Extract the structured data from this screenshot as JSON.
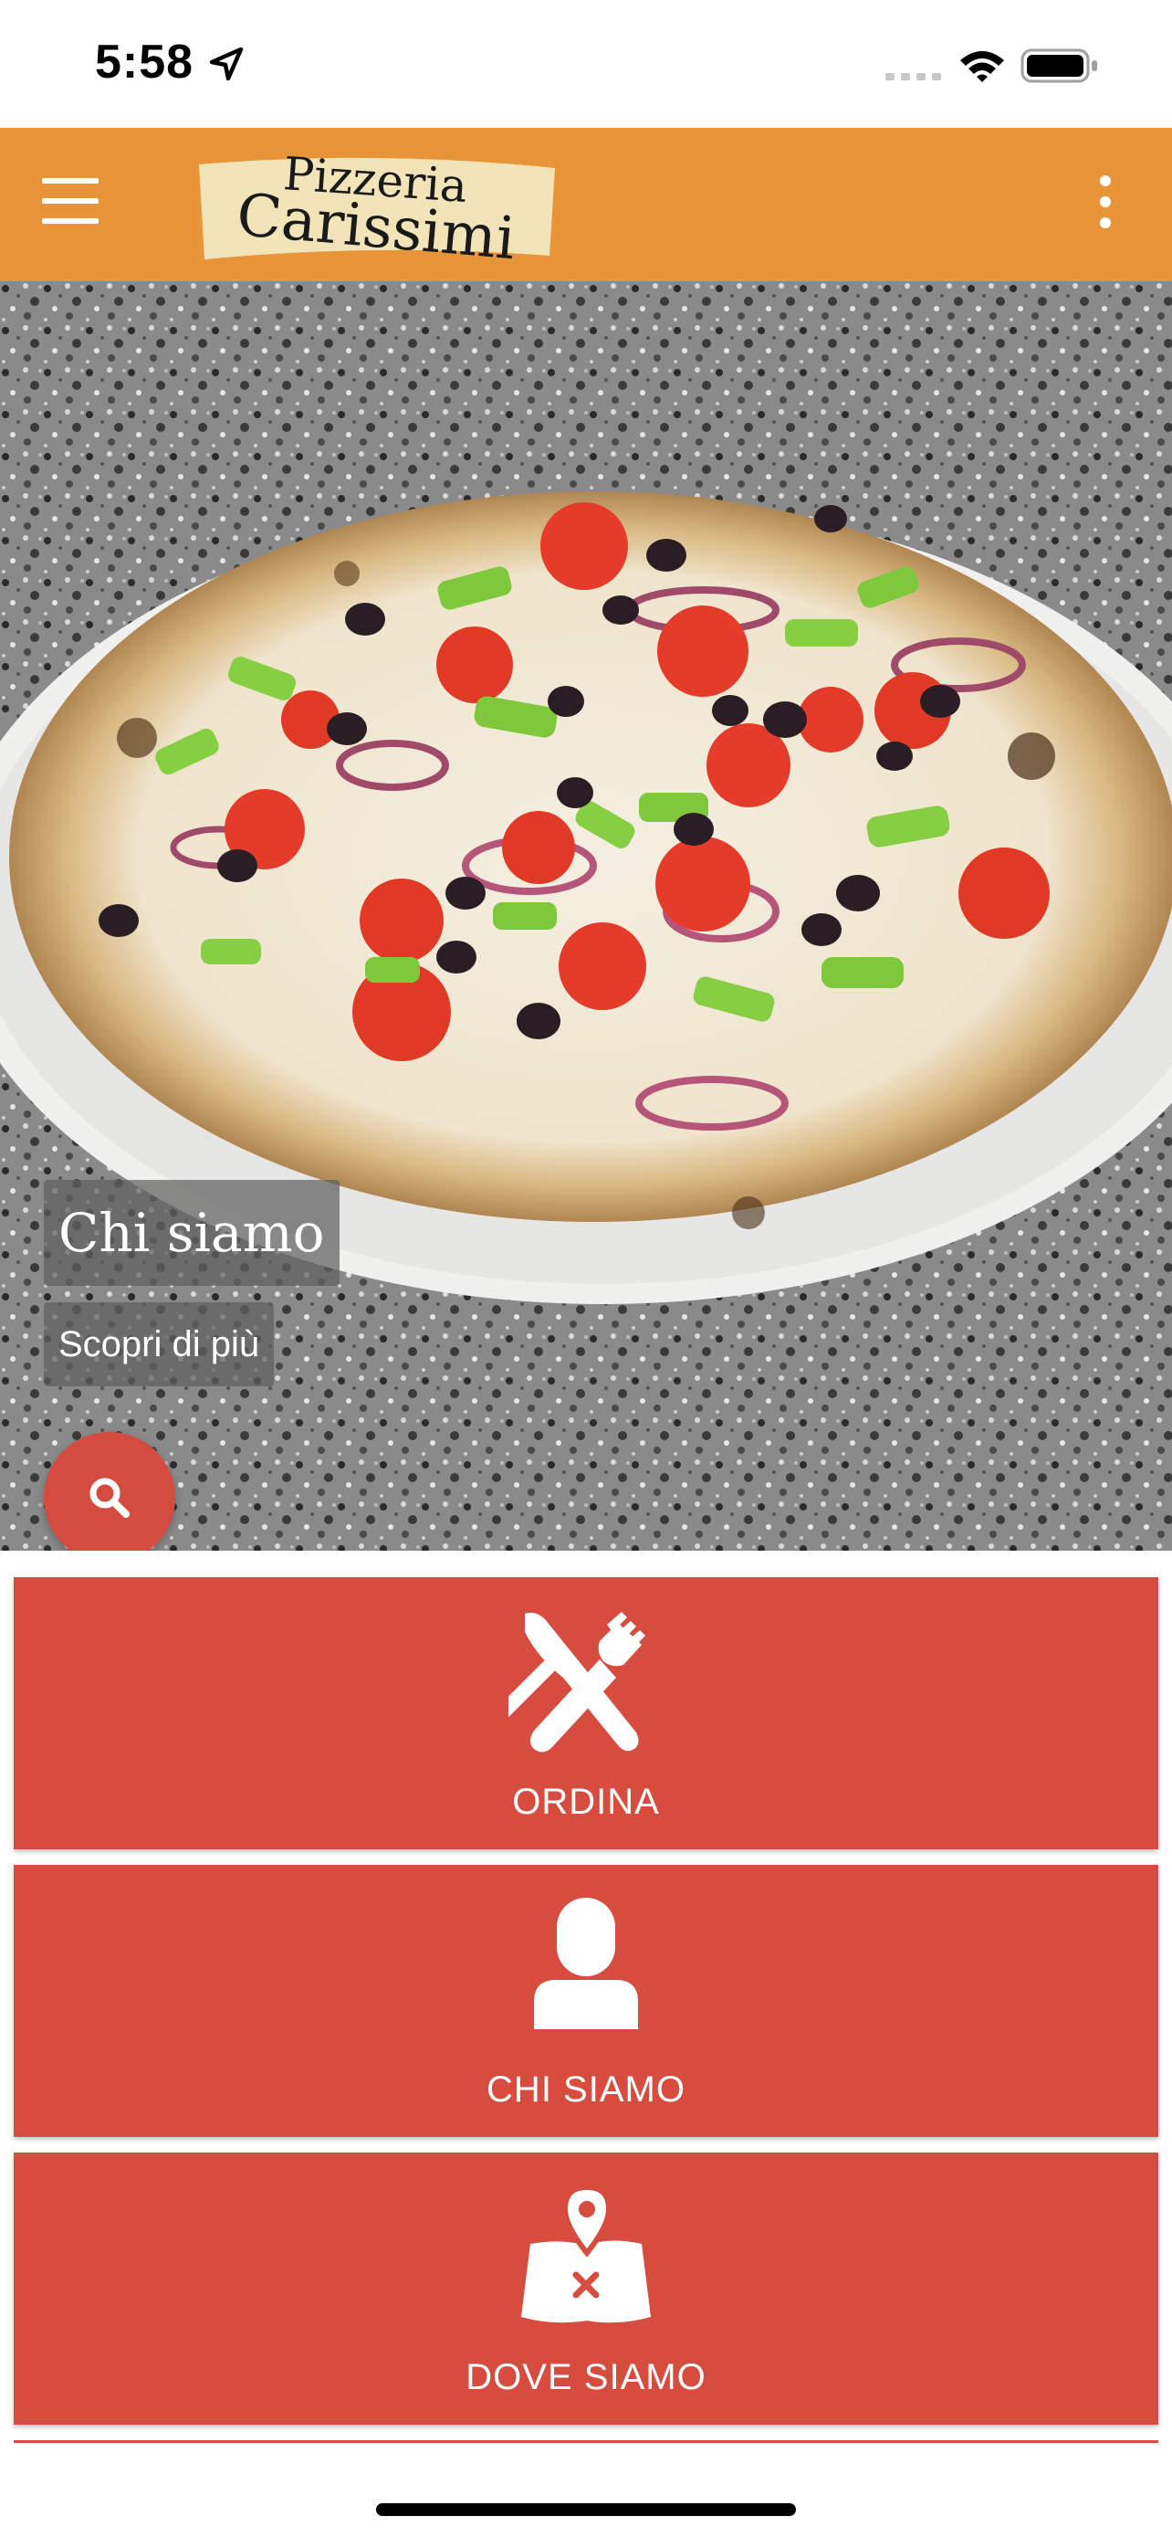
{
  "status_bar": {
    "time": "5:58"
  },
  "header": {
    "logo_line1": "Pizzeria",
    "logo_line2": "Carissimi",
    "accent": "#e8953a"
  },
  "hero": {
    "slide_title": "Chi siamo",
    "slide_link": "Scopri di più",
    "slides_count": 3,
    "active_slide": 1
  },
  "tiles": [
    {
      "label": "ORDINA",
      "icon": "fork-knife-icon"
    },
    {
      "label": "CHI SIAMO",
      "icon": "person-icon"
    },
    {
      "label": "DOVE SIAMO",
      "icon": "map-pin-icon"
    }
  ],
  "colors": {
    "tile": "#d64d40",
    "fab": "#d44c3f"
  }
}
